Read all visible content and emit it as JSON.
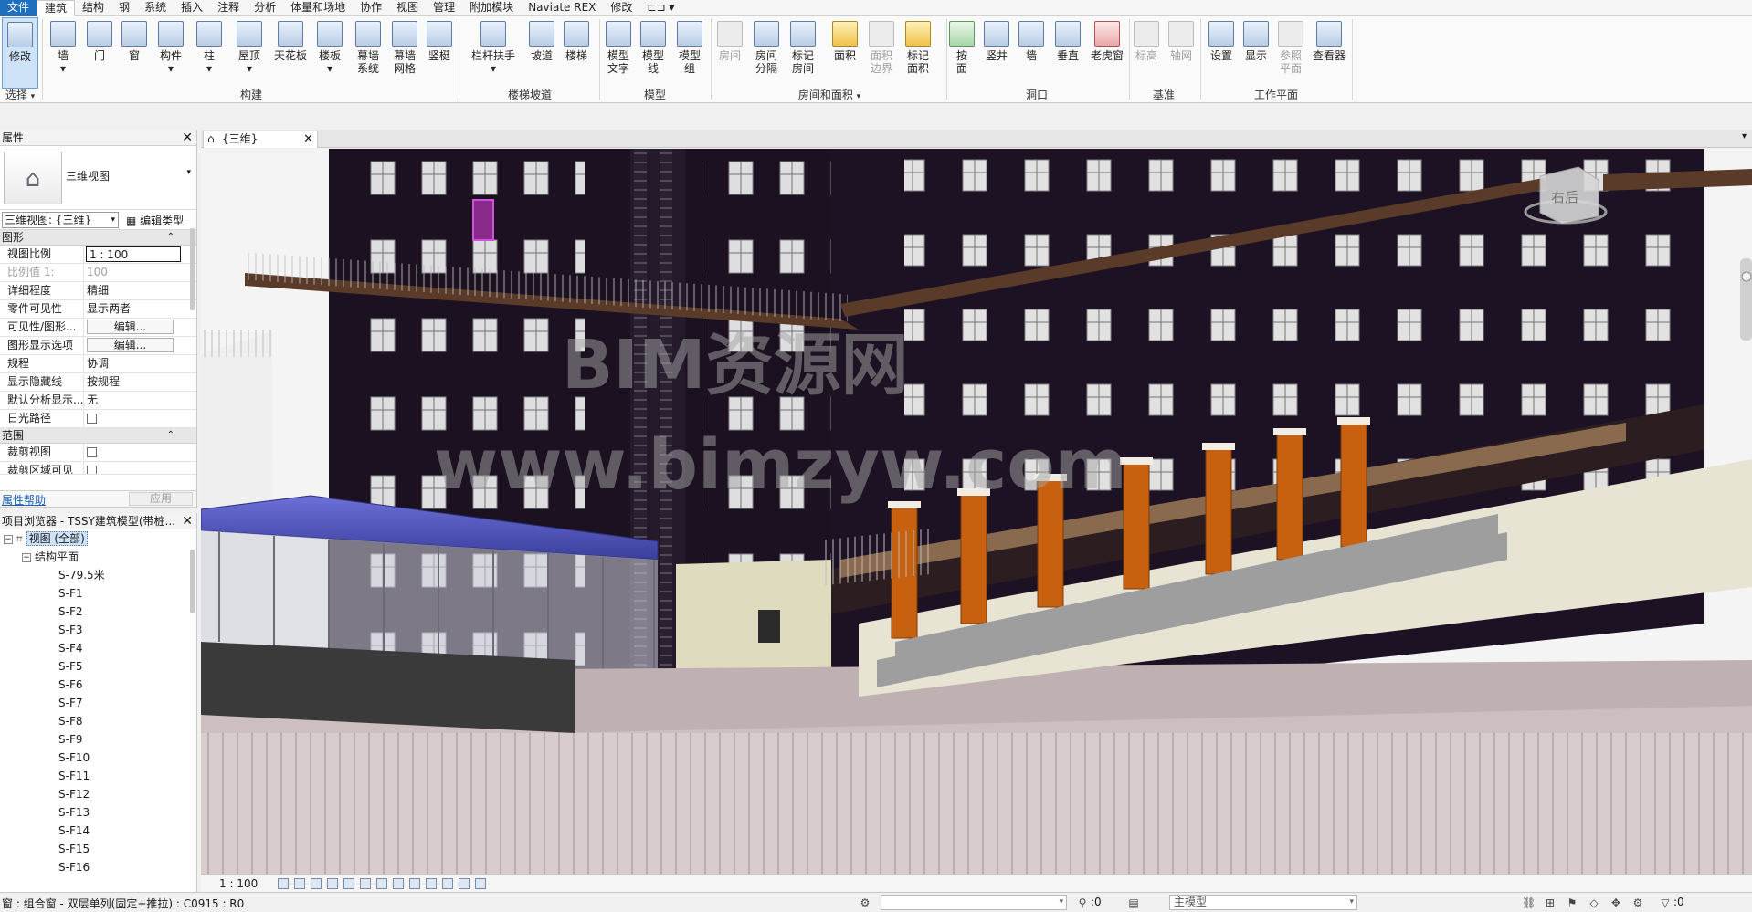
{
  "tabs": [
    {
      "label": "文件"
    },
    {
      "label": "建筑"
    },
    {
      "label": "结构"
    },
    {
      "label": "钢"
    },
    {
      "label": "系统"
    },
    {
      "label": "插入"
    },
    {
      "label": "注释"
    },
    {
      "label": "分析"
    },
    {
      "label": "体量和场地"
    },
    {
      "label": "协作"
    },
    {
      "label": "视图"
    },
    {
      "label": "管理"
    },
    {
      "label": "附加模块"
    },
    {
      "label": "Naviate REX"
    },
    {
      "label": "修改"
    }
  ],
  "ribbon": {
    "modify": "修改",
    "select_panel": "选择",
    "build": {
      "wall": "墙",
      "door": "门",
      "window": "窗",
      "component": "构件",
      "column": "柱",
      "roof": "屋顶",
      "ceiling": "天花板",
      "floor": "楼板",
      "curtain_system": [
        "幕墙",
        "系统"
      ],
      "curtain_grid": [
        "幕墙",
        "网格"
      ],
      "mullion": "竖梃",
      "panel": "构建"
    },
    "circulation": {
      "railing": "栏杆扶手",
      "ramp": "坡道",
      "stair": "楼梯",
      "panel": "楼梯坡道"
    },
    "model": {
      "model_text": [
        "模型",
        "文字"
      ],
      "model_line": [
        "模型",
        "线"
      ],
      "model_group": [
        "模型",
        "组"
      ],
      "panel": "模型"
    },
    "room_area": {
      "room": "房间",
      "room_separator": [
        "房间",
        "分隔"
      ],
      "tag_room": [
        "标记",
        "房间"
      ],
      "area": "面积",
      "area_boundary": [
        "面积",
        "边界"
      ],
      "tag_area": [
        "标记",
        "面积"
      ],
      "panel": "房间和面积"
    },
    "opening": {
      "by_face": [
        "按",
        "面"
      ],
      "shaft": "竖井",
      "wall": "墙",
      "vertical": "垂直",
      "dormer": "老虎窗",
      "panel": "洞口"
    },
    "datum": {
      "level": "标高",
      "grid": "轴网",
      "panel": "基准"
    },
    "work_plane": {
      "set": "设置",
      "show": "显示",
      "ref_plane": [
        "参照",
        "平面"
      ],
      "viewer": "查看器",
      "panel": "工作平面"
    }
  },
  "properties": {
    "title": "属性",
    "type_name": "三维视图",
    "instance_select": "三维视图: {三维}",
    "edit_type": "编辑类型",
    "sections": {
      "graphics": "图形",
      "extents": "范围"
    },
    "rows": [
      {
        "k": "视图比例",
        "v": "1 : 100"
      },
      {
        "k": "比例值 1:",
        "v": "100"
      },
      {
        "k": "详细程度",
        "v": "精细"
      },
      {
        "k": "零件可见性",
        "v": "显示两者"
      },
      {
        "k": "可见性/图形...",
        "v": "编辑..."
      },
      {
        "k": "图形显示选项",
        "v": "编辑..."
      },
      {
        "k": "规程",
        "v": "协调"
      },
      {
        "k": "显示隐藏线",
        "v": "按规程"
      },
      {
        "k": "默认分析显示...",
        "v": "无"
      },
      {
        "k": "日光路径",
        "v": ""
      }
    ],
    "extent_rows": [
      {
        "k": "裁剪视图",
        "v": ""
      },
      {
        "k": "裁剪区域可见",
        "v": ""
      }
    ],
    "help": "属性帮助",
    "apply": "应用"
  },
  "browser": {
    "title": "项目浏览器 - TSSY建筑模型(带桩...",
    "root": "视图 (全部)",
    "group": "结构平面",
    "items": [
      "S-79.5米",
      "S-F1",
      "S-F2",
      "S-F3",
      "S-F4",
      "S-F5",
      "S-F6",
      "S-F7",
      "S-F8",
      "S-F9",
      "S-F10",
      "S-F11",
      "S-F12",
      "S-F13",
      "S-F14",
      "S-F15",
      "S-F16"
    ]
  },
  "view": {
    "tab_label": "{三维}",
    "watermark_1": "BIM资源网",
    "watermark_2": "www.bimzyw.com",
    "viewcube_label": "右后",
    "scale": "1 : 100"
  },
  "status": {
    "message": "窗 : 组合窗 - 双层单列(固定+推拉) : C0915 : R0",
    "filter_count_1": ":0",
    "model_combo": "主模型",
    "filter_count_2": ":0"
  },
  "colors": {
    "file_tab": "#1f6fbf",
    "building_dark": "#1b1121",
    "column_orange": "#c7610f",
    "canopy_blue": "#4a4fb4",
    "podium": "#cdbfbf",
    "watermark": "#a6a6a6"
  }
}
